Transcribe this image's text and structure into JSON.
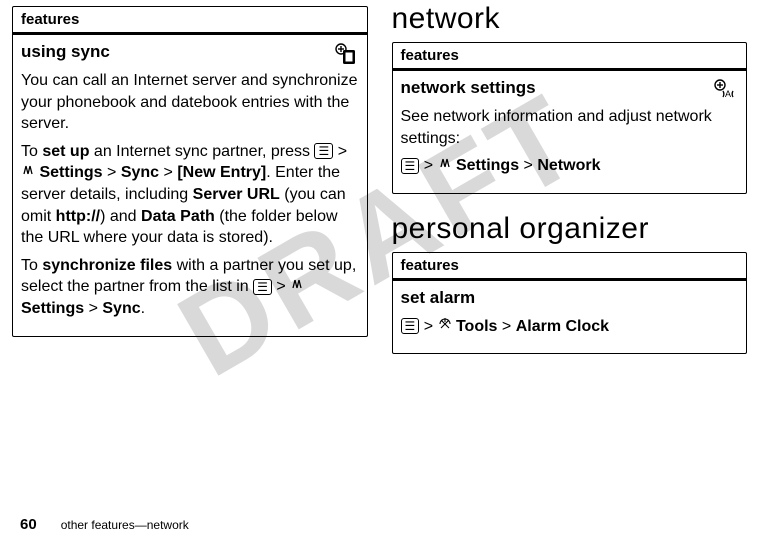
{
  "watermark": "DRAFT",
  "footer": {
    "page_number": "60",
    "text": "other features—network"
  },
  "left": {
    "table_header": "features",
    "row_title": "using sync",
    "para1_a": "You can call an Internet server and synchronize your phonebook and datebook entries with the server.",
    "para2_a": "To ",
    "para2_b": "set up",
    "para2_c": " an Internet sync partner, press ",
    "path1_settings": "Settings",
    "path1_sync": "Sync",
    "path1_newentry": "[New Entry]",
    "para2_d": ". Enter the server details, including ",
    "server_url": "Server URL",
    "para2_e": " (you can omit ",
    "http": "http://",
    "para2_f": ") and ",
    "data_path": "Data Path",
    "para2_g": " (the folder below the URL where your data is stored).",
    "para3_a": "To ",
    "para3_b": "synchronize files",
    "para3_c": " with a partner you set up, select the partner from the list in ",
    "path2_settings": "Settings",
    "path2_sync": "Sync",
    "period": "."
  },
  "right": {
    "section_network": "network",
    "net_table_header": "features",
    "net_row_title": "network settings",
    "net_para1": "See network information and adjust network settings:",
    "net_path_settings": "Settings",
    "net_path_network": "Network",
    "section_personal": "personal organizer",
    "org_table_header": "features",
    "org_row_title": "set alarm",
    "org_path_tools": "Tools",
    "org_path_alarm": "Alarm Clock"
  },
  "glyphs": {
    "gt": ">"
  }
}
